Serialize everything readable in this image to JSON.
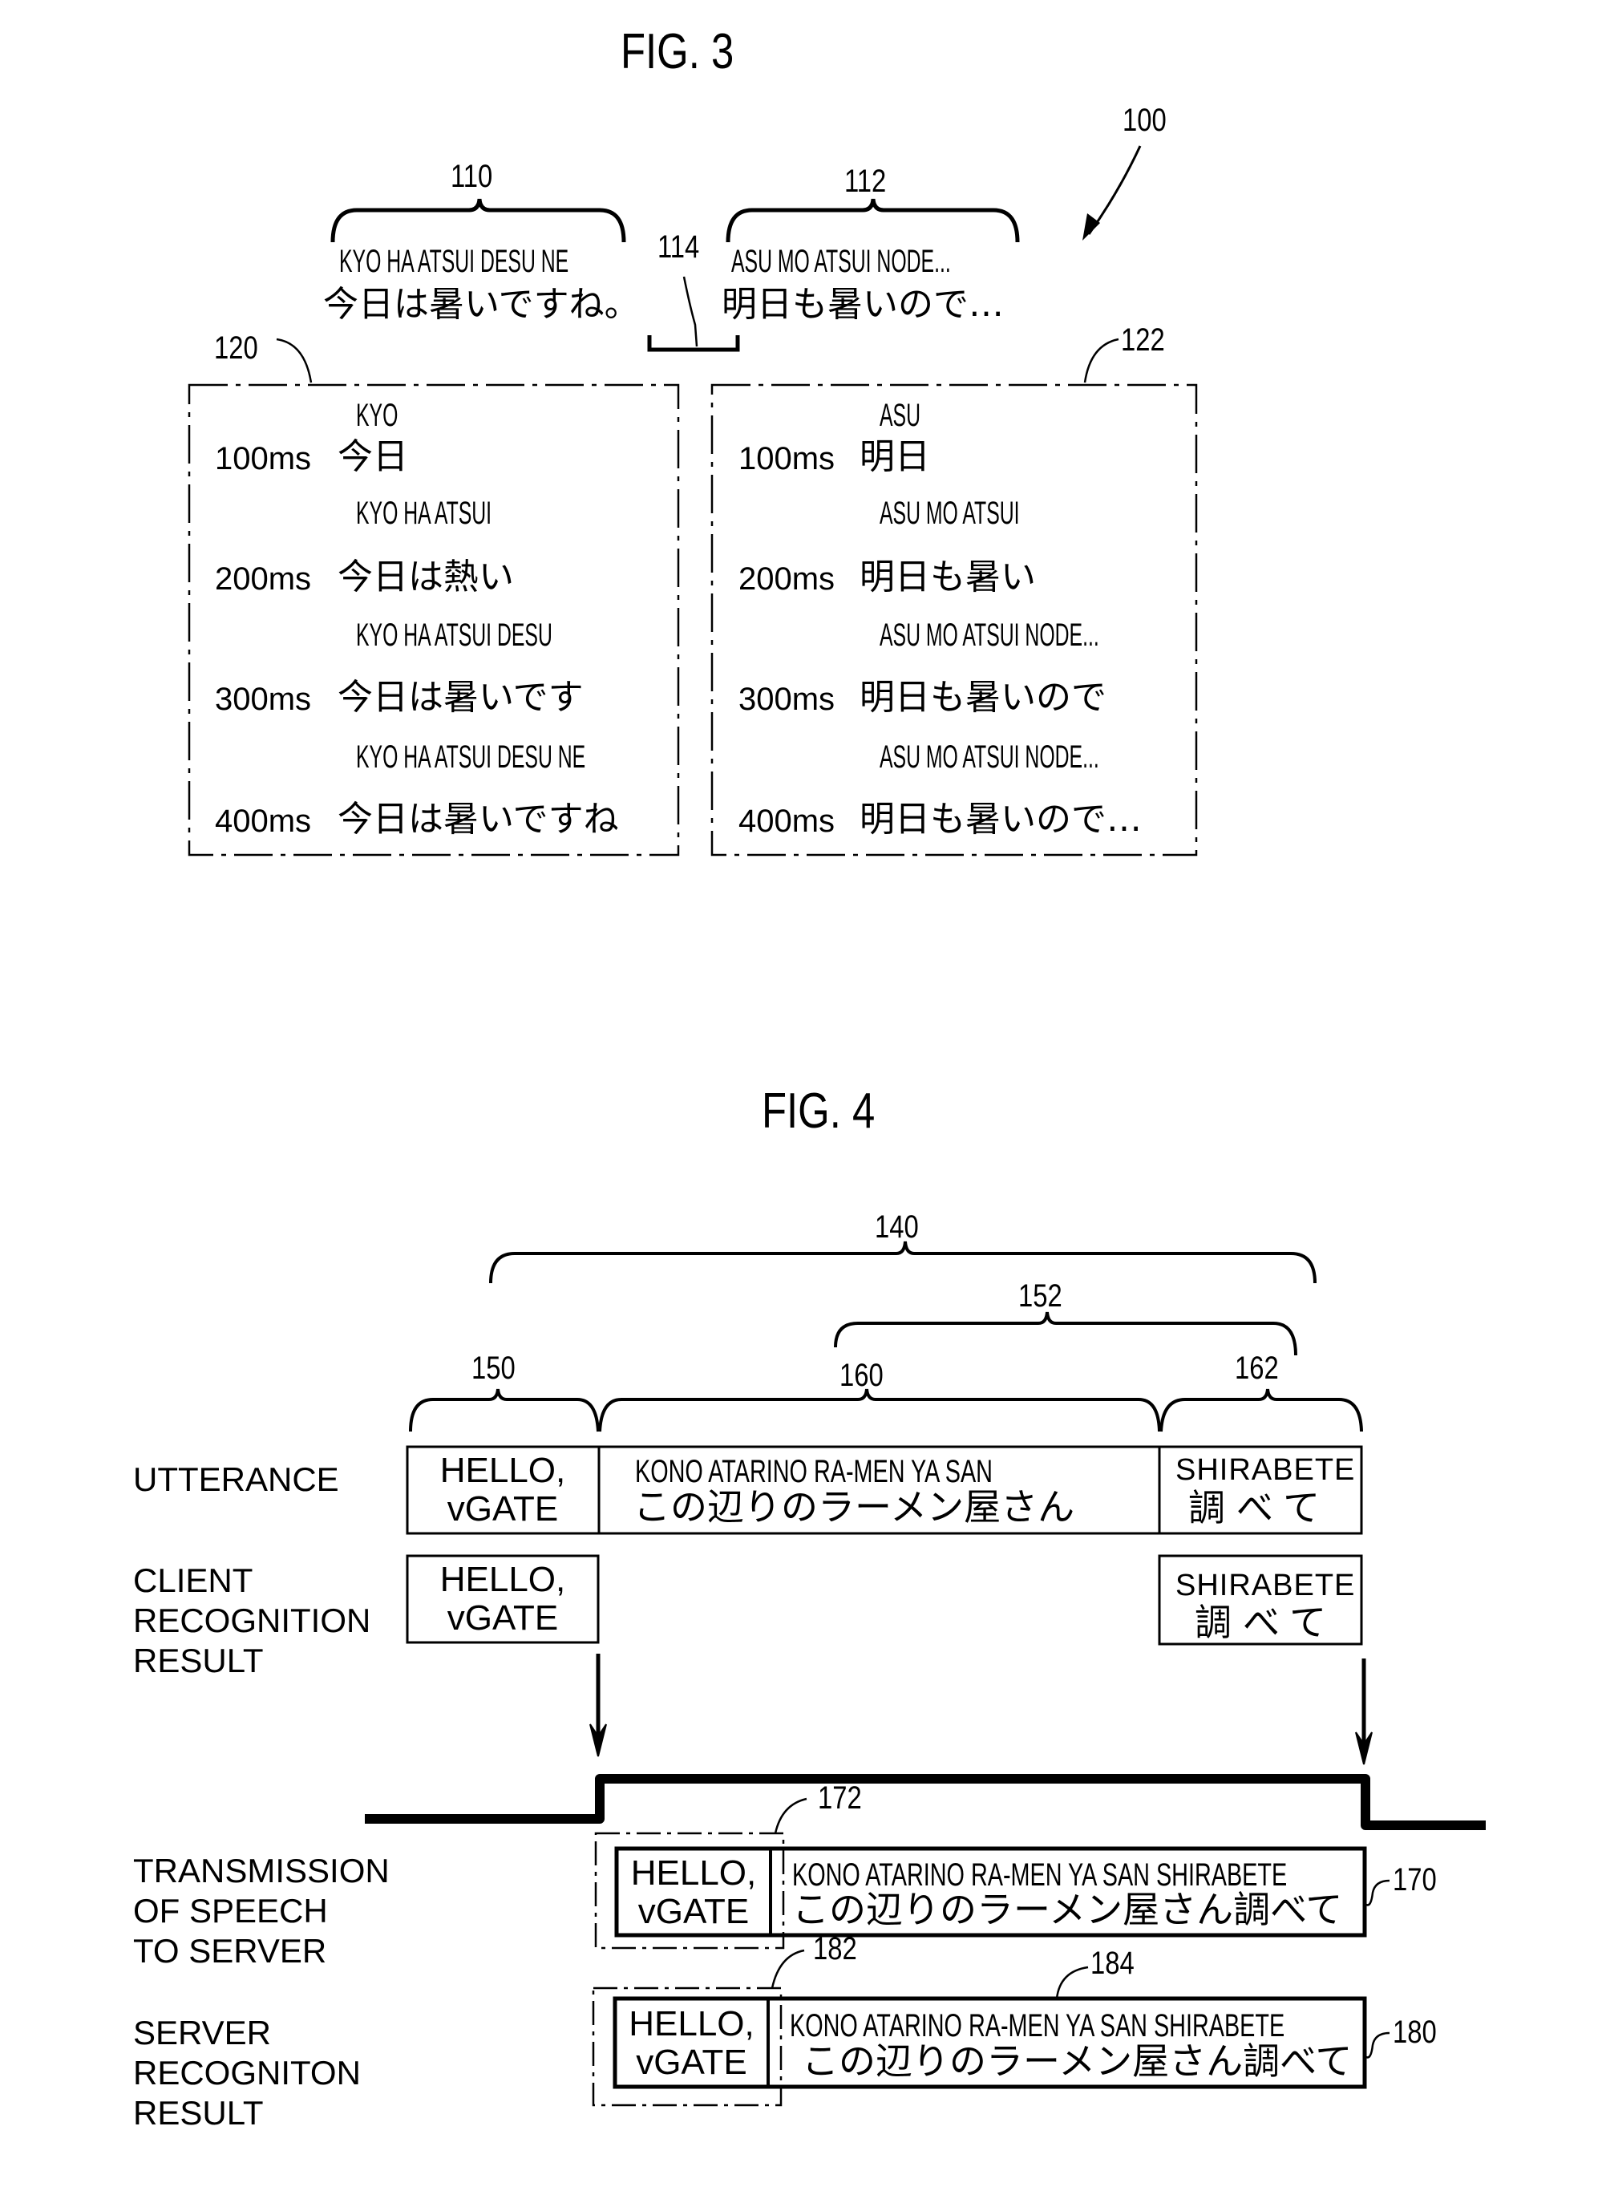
{
  "fig3": {
    "title": "FIG. 3",
    "ref_system": "100",
    "sentence1": {
      "ref": "110",
      "romaji": "KYO  HA  ATSUI  DESU  NE",
      "japanese": "今日は暑いですね。"
    },
    "sentence2": {
      "ref": "112",
      "romaji": "ASU   MO  ATSUI  NODE...",
      "japanese": "明日も暑いので…"
    },
    "boundary_ref": "114",
    "box1": {
      "ref": "120",
      "rows": [
        {
          "time": "100ms",
          "romaji": "KYO",
          "japanese": "今日"
        },
        {
          "time": "200ms",
          "romaji": "KYO  HA  ATSUI",
          "japanese": "今日は熱い"
        },
        {
          "time": "300ms",
          "romaji": "KYO  HA  ATSUI  DESU",
          "japanese": "今日は暑いです"
        },
        {
          "time": "400ms",
          "romaji": "KYO  HA  ATSUI  DESU  NE",
          "japanese": "今日は暑いですね"
        }
      ]
    },
    "box2": {
      "ref": "122",
      "rows": [
        {
          "time": "100ms",
          "romaji": "ASU",
          "japanese": "明日"
        },
        {
          "time": "200ms",
          "romaji": "ASU   MO  ATSUI",
          "japanese": "明日も暑い"
        },
        {
          "time": "300ms",
          "romaji": "ASU   MO  ATSUI  NODE...",
          "japanese": "明日も暑いので"
        },
        {
          "time": "400ms",
          "romaji": "ASU   MO  ATSUI  NODE...",
          "japanese": "明日も暑いので…"
        }
      ]
    }
  },
  "fig4": {
    "title": "FIG. 4",
    "braces": {
      "whole": "140",
      "server_part": "152",
      "hello": "150",
      "middle": "160",
      "shirabete": "162"
    },
    "row_labels": {
      "utterance": "UTTERANCE",
      "client": "CLIENT\nRECOGNITION\nRESULT",
      "transmission": "TRANSMISSION\nOF SPEECH\nTO SERVER",
      "server": "SERVER\nRECOGNITON\nRESULT"
    },
    "utterance": {
      "hello": "HELLO,\nvGATE",
      "middle_romaji": "KONO ATARINO RA-MEN YA SAN",
      "middle_japanese": "この辺りのラーメン屋さん",
      "end_romaji": "SHIRABETE",
      "end_japanese": "調べて"
    },
    "client_result": {
      "hello": "HELLO,\nvGATE",
      "end_romaji": "SHIRABETE",
      "end_japanese": "調べて"
    },
    "transmission": {
      "ref": "170",
      "hello_ref": "172",
      "hello": "HELLO,\nvGATE",
      "romaji": "KONO ATARINO RA-MEN YA SAN  SHIRABETE",
      "japanese": "この辺りのラーメン屋さん調べて"
    },
    "server_result": {
      "ref": "180",
      "hello_ref": "182",
      "text_ref": "184",
      "hello": "HELLO,\nvGATE",
      "romaji": "KONO ATARINO RA-MEN YA SAN  SHIRABETE",
      "japanese": "この辺りのラーメン屋さん調べて"
    }
  }
}
